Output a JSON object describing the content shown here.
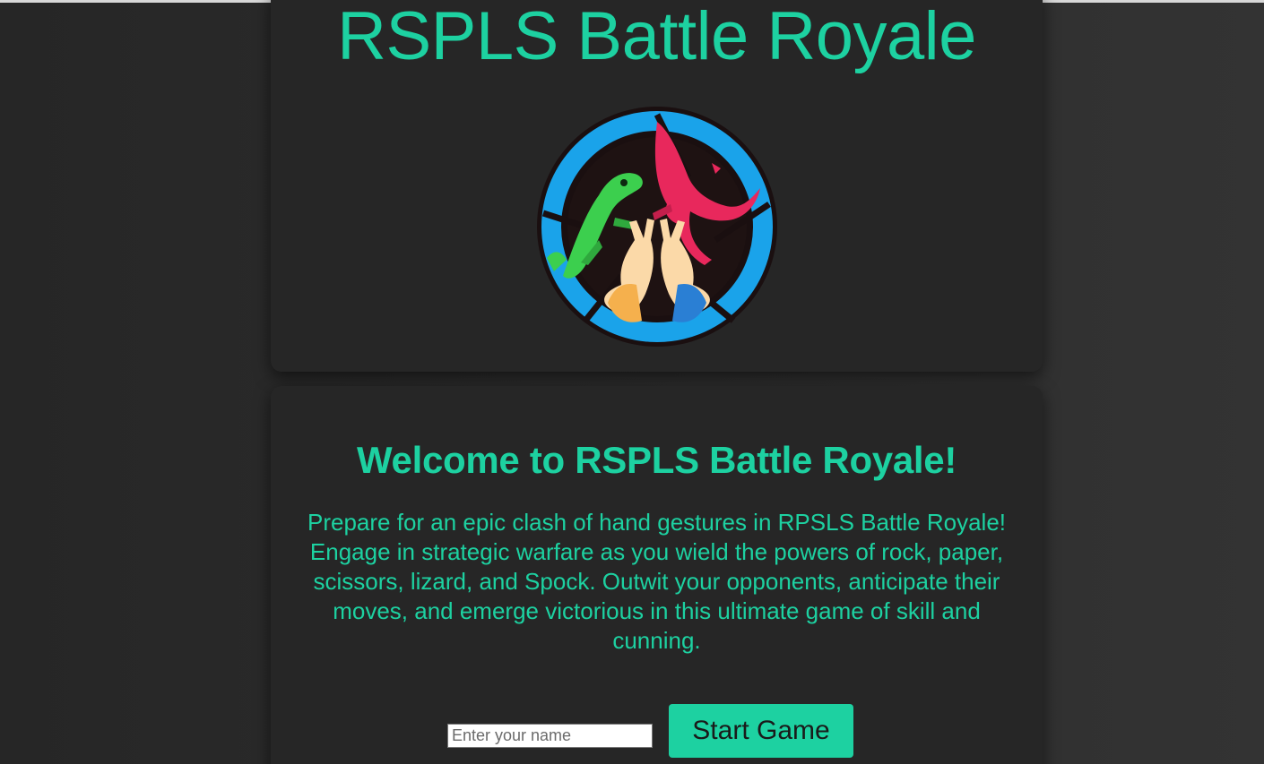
{
  "header": {
    "title": "RSPLS Battle Royale",
    "logo_icon": "rpsls-lizard-hands-logo-icon"
  },
  "main": {
    "welcome_heading": "Welcome to RSPLS Battle Royale!",
    "description": "Prepare for an epic clash of hand gestures in RPSLS Battle Royale! Engage in strategic warfare as you wield the powers of rock, paper, scissors, lizard, and Spock. Outwit your opponents, anticipate their moves, and emerge victorious in this ultimate game of skill and cunning.",
    "name_input": {
      "value": "",
      "placeholder": "Enter your name"
    },
    "start_button_label": "Start Game"
  },
  "colors": {
    "accent": "#1dd1a1",
    "card_bg": "#262626",
    "page_bg": "#2b2b2b"
  }
}
